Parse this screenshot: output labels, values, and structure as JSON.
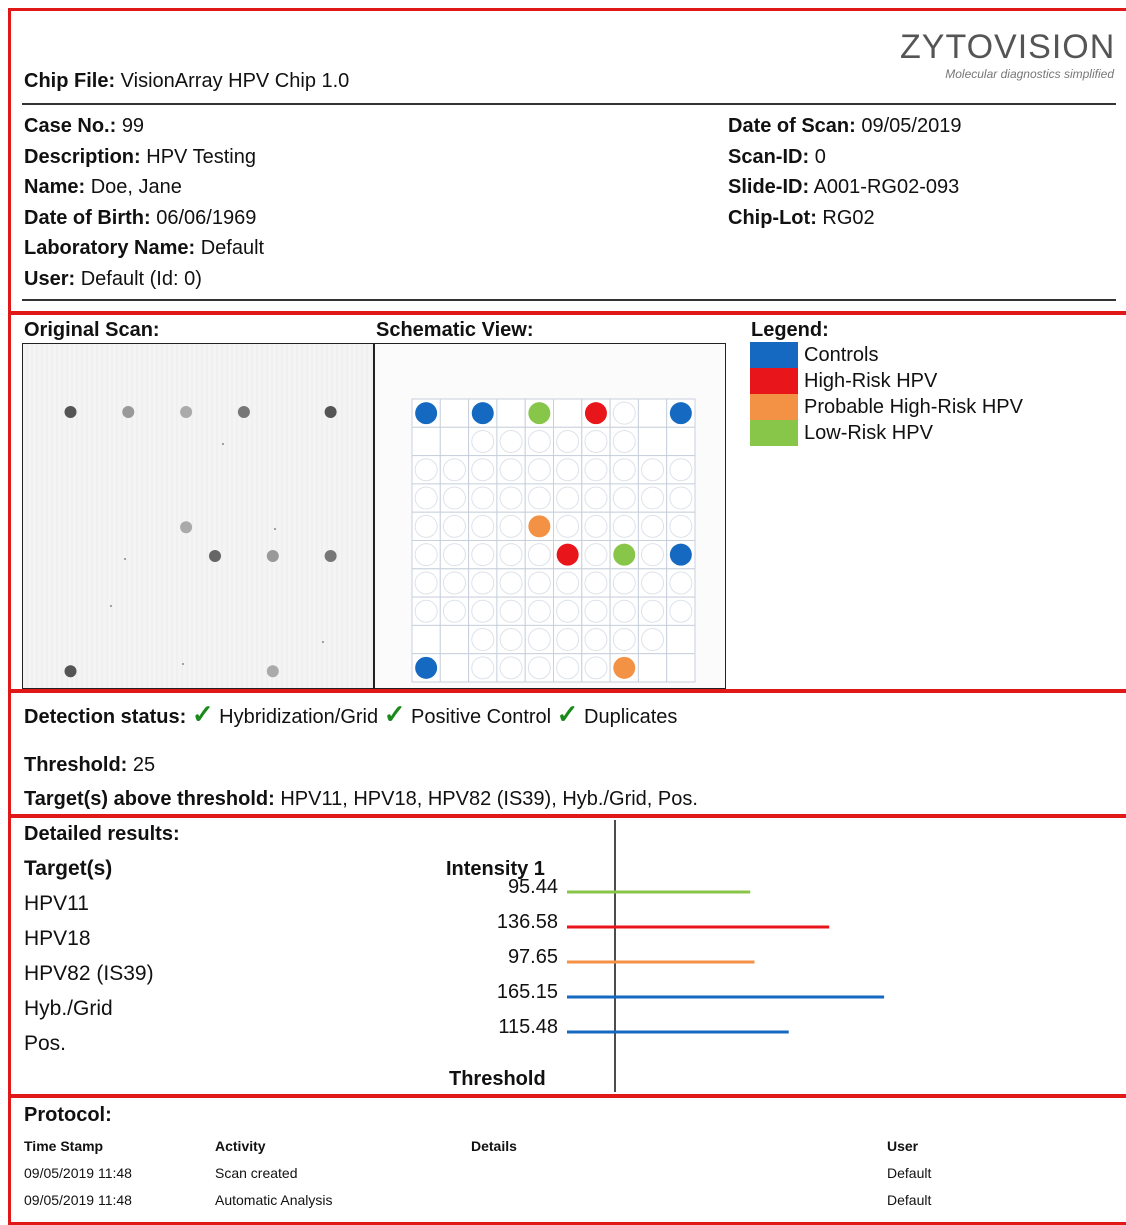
{
  "header": {
    "chip_file_label": "Chip File:",
    "chip_file_value": "VisionArray HPV Chip 1.0",
    "logo_text": "ZYTOVISION",
    "logo_tagline": "Molecular diagnostics simplified"
  },
  "patient": {
    "left": [
      {
        "label": "Case No.:",
        "value": "99"
      },
      {
        "label": "Description:",
        "value": "HPV Testing"
      },
      {
        "label": "Name:",
        "value": "Doe, Jane"
      },
      {
        "label": "Date of Birth:",
        "value": "06/06/1969"
      },
      {
        "label": "Laboratory Name:",
        "value": "Default"
      },
      {
        "label": "User:",
        "value": "Default (Id: 0)"
      }
    ],
    "right": [
      {
        "label": "Date of Scan:",
        "value": "09/05/2019"
      },
      {
        "label": "Scan-ID:",
        "value": "0"
      },
      {
        "label": "Slide-ID:",
        "value": "A001-RG02-093"
      },
      {
        "label": "Chip-Lot:",
        "value": "RG02"
      }
    ]
  },
  "views": {
    "original_label": "Original Scan:",
    "schematic_label": "Schematic View:",
    "legend_label": "Legend:",
    "legend": [
      {
        "label": "Controls",
        "color": "#1569c0"
      },
      {
        "label": "High-Risk HPV",
        "color": "#e8161b"
      },
      {
        "label": "Probable High-Risk HPV",
        "color": "#f39244"
      },
      {
        "label": "Low-Risk HPV",
        "color": "#88c64a"
      }
    ]
  },
  "grid": {
    "rows": 10,
    "cols": 10,
    "colored_spots": [
      {
        "row": 0,
        "col": 0,
        "color": "#1569c0"
      },
      {
        "row": 0,
        "col": 2,
        "color": "#1569c0"
      },
      {
        "row": 0,
        "col": 4,
        "color": "#88c64a"
      },
      {
        "row": 0,
        "col": 6,
        "color": "#e8161b"
      },
      {
        "row": 0,
        "col": 9,
        "color": "#1569c0"
      },
      {
        "row": 4,
        "col": 4,
        "color": "#f39244"
      },
      {
        "row": 5,
        "col": 5,
        "color": "#e8161b"
      },
      {
        "row": 5,
        "col": 7,
        "color": "#88c64a"
      },
      {
        "row": 5,
        "col": 9,
        "color": "#1569c0"
      },
      {
        "row": 9,
        "col": 0,
        "color": "#1569c0"
      },
      {
        "row": 9,
        "col": 7,
        "color": "#f39244"
      }
    ],
    "empty_cells": [
      [
        0,
        1
      ],
      [
        0,
        3
      ],
      [
        0,
        5
      ],
      [
        0,
        8
      ],
      [
        1,
        0
      ],
      [
        1,
        1
      ],
      [
        1,
        8
      ],
      [
        1,
        9
      ],
      [
        8,
        0
      ],
      [
        8,
        1
      ],
      [
        8,
        9
      ],
      [
        9,
        1
      ],
      [
        9,
        8
      ],
      [
        9,
        9
      ]
    ]
  },
  "scan_spots": [
    {
      "row": 0,
      "col": 0,
      "shade": "#555"
    },
    {
      "row": 0,
      "col": 2,
      "shade": "#999"
    },
    {
      "row": 0,
      "col": 4,
      "shade": "#aaa"
    },
    {
      "row": 0,
      "col": 6,
      "shade": "#777"
    },
    {
      "row": 0,
      "col": 9,
      "shade": "#555"
    },
    {
      "row": 4,
      "col": 4,
      "shade": "#aaa"
    },
    {
      "row": 5,
      "col": 5,
      "shade": "#666"
    },
    {
      "row": 5,
      "col": 7,
      "shade": "#999"
    },
    {
      "row": 5,
      "col": 9,
      "shade": "#777"
    },
    {
      "row": 9,
      "col": 0,
      "shade": "#555"
    },
    {
      "row": 9,
      "col": 7,
      "shade": "#aaa"
    }
  ],
  "detection": {
    "label": "Detection status:",
    "checks": [
      "Hybridization/Grid",
      "Positive Control",
      "Duplicates"
    ],
    "threshold_label": "Threshold:",
    "threshold_value": "25",
    "targets_label": "Target(s) above threshold:",
    "targets_value": "HPV11, HPV18, HPV82 (IS39), Hyb./Grid, Pos."
  },
  "results": {
    "title": "Detailed results:",
    "targets_header": "Target(s)",
    "intensity_header": "Intensity 1",
    "threshold_footer": "Threshold"
  },
  "chart_data": {
    "type": "bar",
    "orientation": "horizontal",
    "categories": [
      "HPV11",
      "HPV18",
      "HPV82 (IS39)",
      "Hyb./Grid",
      "Pos."
    ],
    "values": [
      95.44,
      136.58,
      97.65,
      165.15,
      115.48
    ],
    "value_labels": [
      "95.44",
      "136.58",
      "97.65",
      "165.15",
      "115.48"
    ],
    "colors": [
      "#88c64a",
      "#e8161b",
      "#f39244",
      "#1569c0",
      "#1569c0"
    ],
    "threshold": 25
  },
  "protocol": {
    "title": "Protocol:",
    "headers": [
      "Time Stamp",
      "Activity",
      "Details",
      "User"
    ],
    "rows": [
      [
        "09/05/2019 11:48",
        "Scan created",
        "",
        "Default"
      ],
      [
        "09/05/2019 11:48",
        "Automatic Analysis",
        "",
        "Default"
      ]
    ]
  }
}
